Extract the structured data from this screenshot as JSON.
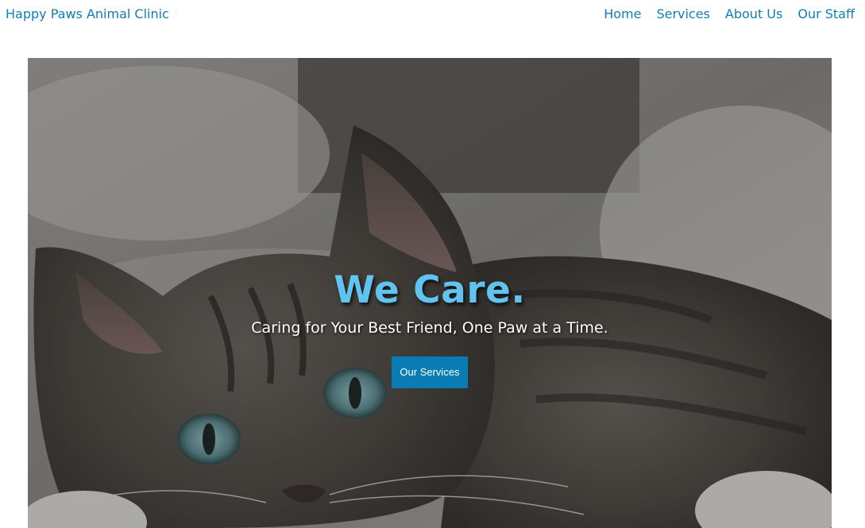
{
  "header": {
    "brand": "Happy Paws Animal Clinic",
    "nav": [
      {
        "label": "Home"
      },
      {
        "label": "Services"
      },
      {
        "label": "About Us"
      },
      {
        "label": "Our Staff"
      }
    ]
  },
  "hero": {
    "title": "We Care.",
    "subtitle": "Caring for Your Best Friend, One Paw at a Time.",
    "cta_label": "Our Services",
    "image_subject": "tabby kitten lying on a blanket"
  },
  "colors": {
    "brand": "#0f7fb3",
    "hero_title": "#61c3f0",
    "cta_background": "#0a7cb4"
  }
}
